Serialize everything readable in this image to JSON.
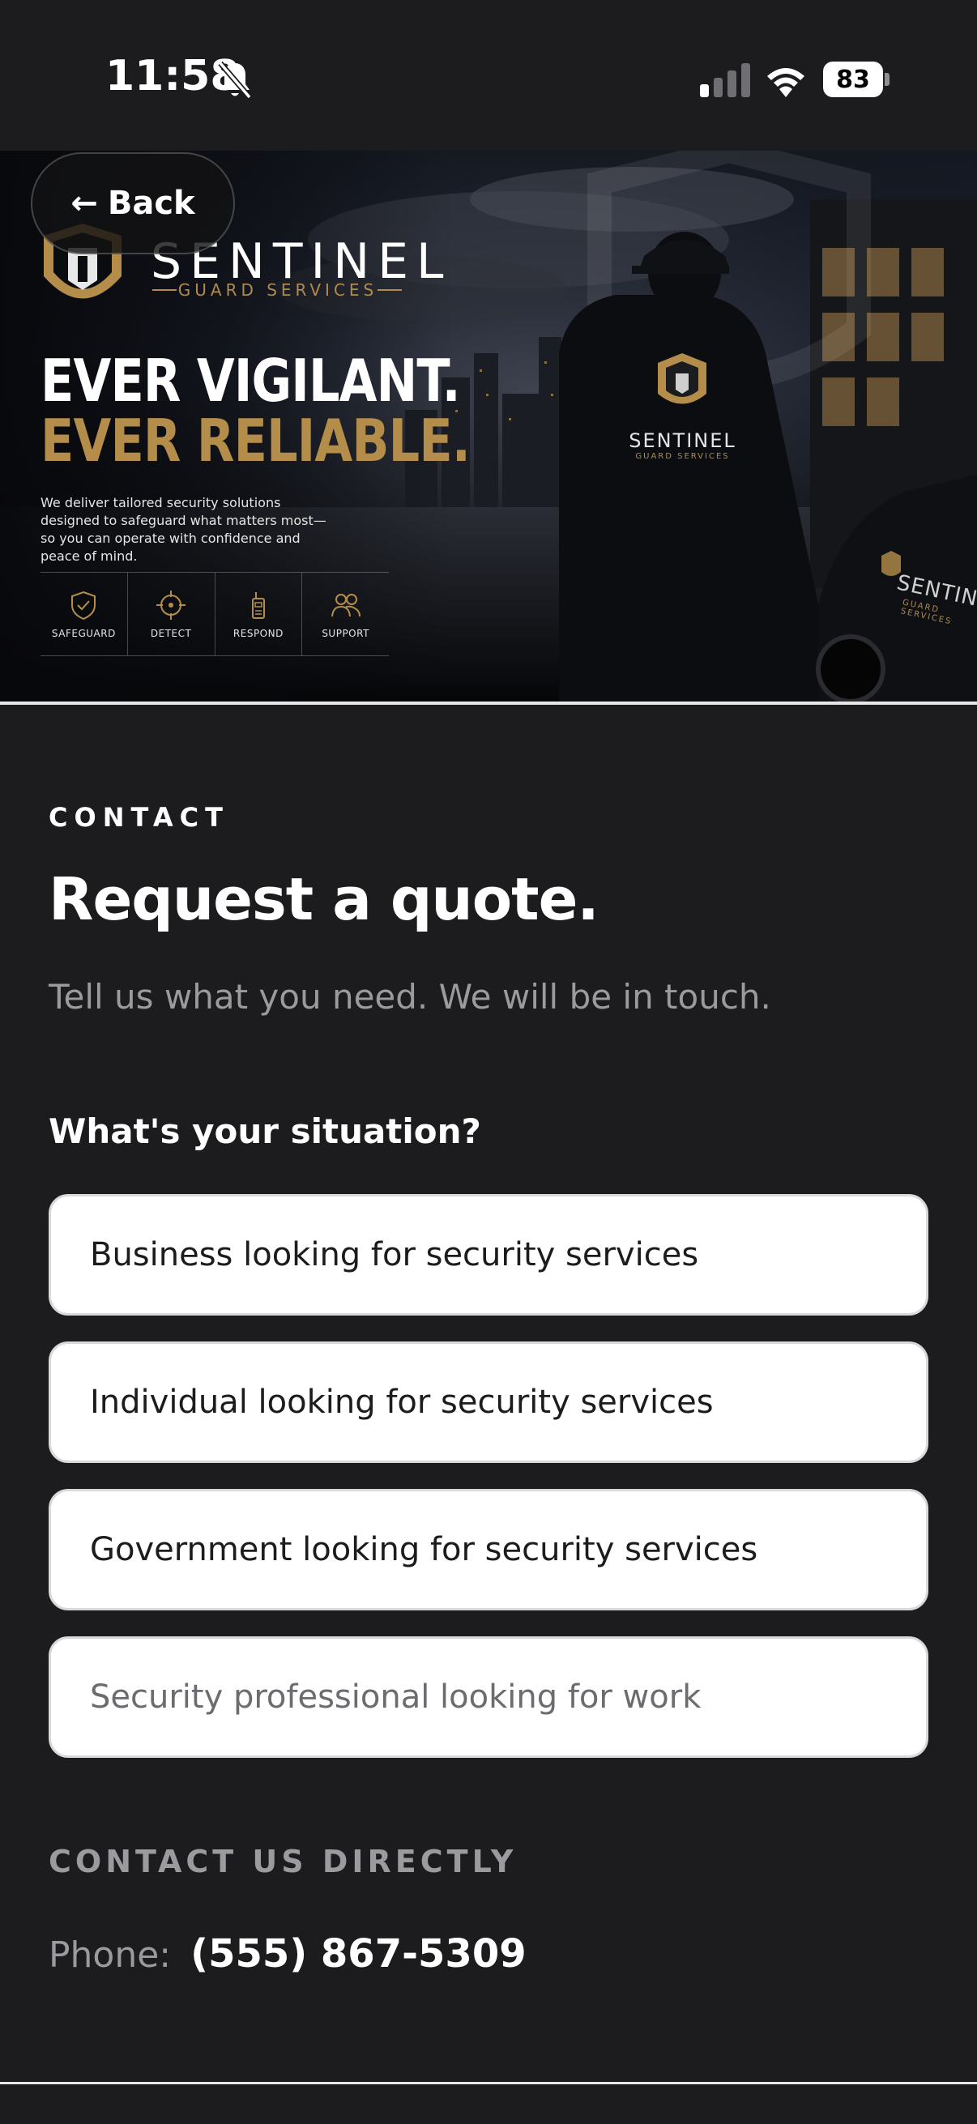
{
  "status_bar": {
    "time": "11:58",
    "battery": "83",
    "icons": [
      "bell-muted-icon",
      "cellular-signal-icon",
      "wifi-icon",
      "battery-icon"
    ]
  },
  "hero": {
    "back_label": "Back",
    "brand": "SENTINEL",
    "brand_sub": "GUARD SERVICES",
    "headline_1": "EVER VIGILANT.",
    "headline_2": "EVER RELIABLE.",
    "description": "We deliver tailored security solutions designed to safeguard what matters most—so you can operate with confidence and peace of mind.",
    "features": [
      {
        "label": "SAFEGUARD",
        "icon": "shield-check-icon"
      },
      {
        "label": "DETECT",
        "icon": "crosshair-icon"
      },
      {
        "label": "RESPOND",
        "icon": "radio-icon"
      },
      {
        "label": "SUPPORT",
        "icon": "people-icon"
      }
    ],
    "jacket_brand": "SENTINEL",
    "jacket_sub": "GUARD SERVICES",
    "car_brand": "SENTINEL",
    "car_sub": "GUARD SERVICES",
    "accent_color": "#b58d4b"
  },
  "contact": {
    "eyebrow": "CONTACT",
    "title": "Request a quote.",
    "subtitle": "Tell us what you need. We will be in touch.",
    "question": "What's your situation?",
    "options": [
      {
        "label": "Business looking for security services"
      },
      {
        "label": "Individual looking for security services"
      },
      {
        "label": "Government looking for security services"
      },
      {
        "label": "Security professional looking for work"
      }
    ],
    "direct_heading": "CONTACT US DIRECTLY",
    "phone_label": "Phone:",
    "phone_number": "(555) 867-5309"
  }
}
